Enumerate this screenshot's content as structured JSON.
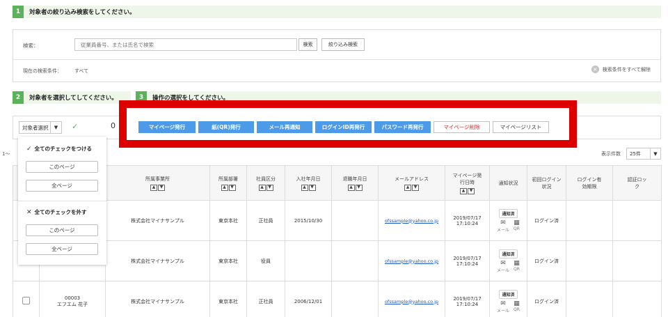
{
  "step1": {
    "num": "1",
    "text": "対象者の絞り込み検索をしてください。"
  },
  "search": {
    "label": "検索：",
    "placeholder": "従業員番号、または氏名で検索",
    "search_button": "検索",
    "filter_button": "絞り込み検索",
    "condition_label": "現在の検索条件：",
    "condition_value": "すべて",
    "clear_label": "検索条件をすべて解除"
  },
  "step2": {
    "num": "2",
    "text": "対象者を選択してしてください。"
  },
  "step3": {
    "num": "3",
    "text": "操作の選択をしてください。"
  },
  "toolbar": {
    "select_label": "対象者選択",
    "count_fragment": "0"
  },
  "actions": [
    {
      "label": "マイページ発行",
      "style": "blue"
    },
    {
      "label": "紙(QR)発行",
      "style": "blue"
    },
    {
      "label": "メール再通知",
      "style": "blue"
    },
    {
      "label": "ログインID再発行",
      "style": "blue"
    },
    {
      "label": "パスワード再発行",
      "style": "blue"
    },
    {
      "label": "マイページ削除",
      "style": "red"
    },
    {
      "label": "マイページリスト",
      "style": "white"
    }
  ],
  "paging": {
    "left_fragment": "1～",
    "count_label": "表示件数",
    "count_value": "25件"
  },
  "popup": {
    "check_all": "全てのチェックをつける",
    "uncheck_all": "全てのチェックを外す",
    "this_page": "このページ",
    "all_pages": "全ページ"
  },
  "table": {
    "headers": {
      "office": "所属事業所",
      "dept": "所属部署",
      "type": "社員区分",
      "join": "入社年月日",
      "leave": "退職年月日",
      "email": "メールアドレス",
      "issued": "マイページ発行日時",
      "notice": "通知状況",
      "first_login": "初回ログイン状況",
      "login_expiry": "ログイン有効期限",
      "auth_lock": "認証ロック"
    },
    "rows": [
      {
        "id": "",
        "name": "",
        "office": "株式会社マイナサンプル",
        "dept": "東京本社",
        "type": "正社員",
        "join": "2015/10/30",
        "leave": "",
        "email": "ofssample@yahoo.co.jp",
        "issued_date": "2019/07/17",
        "issued_time": "17:10:24",
        "notice_badge": "通知済",
        "mail": "メール",
        "qr": "QR",
        "first_login": "ログイン済"
      },
      {
        "id": "",
        "name": "",
        "office": "株式会社マイナサンプル",
        "dept": "東京本社",
        "type": "役員",
        "join": "",
        "leave": "",
        "email": "ofssample@yahoo.co.jp",
        "issued_date": "2019/07/17",
        "issued_time": "17:10:24",
        "notice_badge": "通知済",
        "mail": "メール",
        "qr": "QR",
        "first_login": "ログイン済"
      },
      {
        "id": "00003",
        "name": "エフエム 花子",
        "office": "株式会社マイナサンプル",
        "dept": "東京本社",
        "type": "正社員",
        "join": "2006/12/01",
        "leave": "",
        "email": "ofssample@yahoo.co.jp",
        "issued_date": "2019/07/17",
        "issued_time": "17:10:24",
        "notice_badge": "通知済",
        "mail": "メール",
        "qr": "QR",
        "first_login": "ログイン済"
      }
    ]
  },
  "colors": {
    "accent_green": "#5ab25a",
    "action_blue": "#4d9be8",
    "highlight_red": "#dd0000",
    "link_blue": "#1a58c4"
  }
}
